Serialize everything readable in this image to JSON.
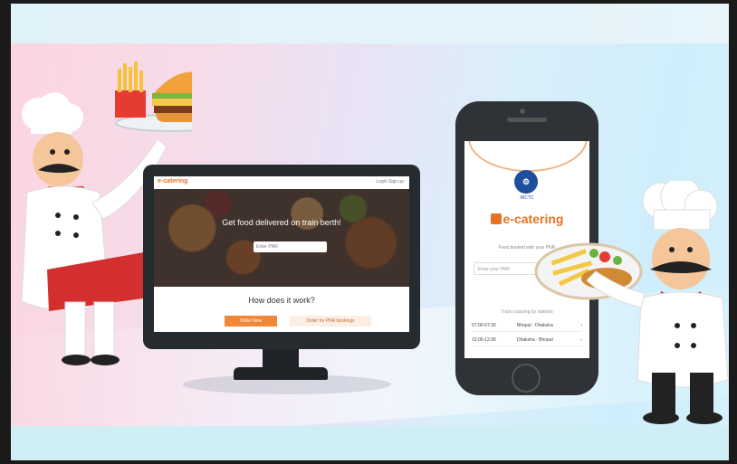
{
  "desktop_site": {
    "logo": "e-catering",
    "nav": "Login  Sign up",
    "hero_title": "Get food delivered on train berth!",
    "search_placeholder": "Enter PNR",
    "how_heading": "How does it work?",
    "primary_cta": "Order Now",
    "secondary_cta": "Order for PNR bookings"
  },
  "phone_app": {
    "brand_label": "IRCTC",
    "app_name": "e-catering",
    "prompt": "Food booked with your PNR",
    "pnr_placeholder": "Enter your PNR",
    "list_caption": "Trains passing by stations",
    "rows": [
      {
        "time": "07:00-07:30",
        "route": "Bhopal - Dhaksha"
      },
      {
        "time": "12:00-12:30",
        "route": "Dhaksha - Bhopal"
      }
    ]
  },
  "colors": {
    "brand_orange": "#e9731f",
    "irctc_blue": "#1f4e9c",
    "device_dark": "#262b30"
  }
}
